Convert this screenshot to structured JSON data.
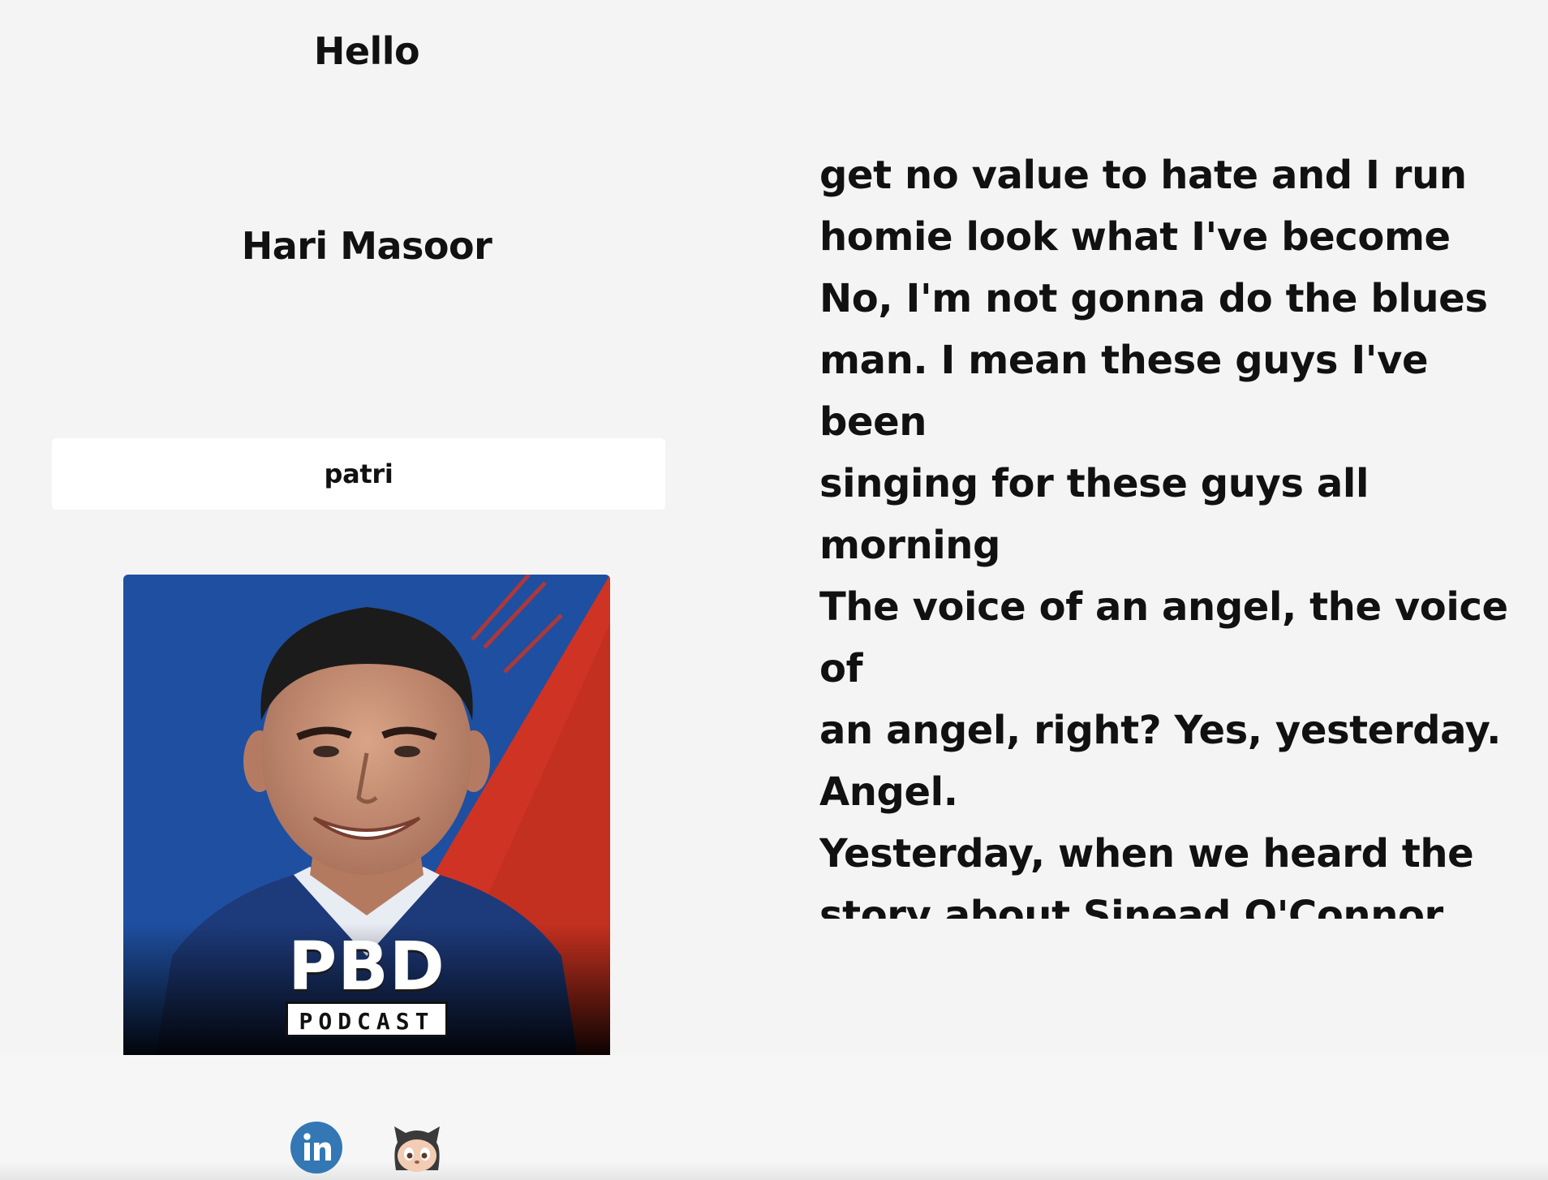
{
  "header": {
    "greeting": "Hello",
    "name": "Hari Masoor"
  },
  "search": {
    "value": "patri"
  },
  "podcast": {
    "cover_title": "PBD",
    "cover_subtitle": "PODCAST",
    "colors": {
      "left_panel": "#1f4fa0",
      "right_panel": "#cf3323",
      "suit": "#1d3a7a"
    }
  },
  "transcript": {
    "text": "this world of entrepreneurs. We\nget no value to hate and I run\nhomie look what I've become\nNo, I'm not gonna do the blues\nman. I mean these guys I've been\nsinging for these guys all morning\nThe voice of an angel, the voice of\nan angel, right? Yes, yesterday.\nAngel.\nYesterday, when we heard the\nstory about Sinead O'Connor,\nwhich is obviously, everybody\nknows"
  },
  "footer": {
    "icons": [
      "linkedin-icon",
      "github-icon"
    ],
    "colors": {
      "linkedin": "#3477b5"
    }
  }
}
